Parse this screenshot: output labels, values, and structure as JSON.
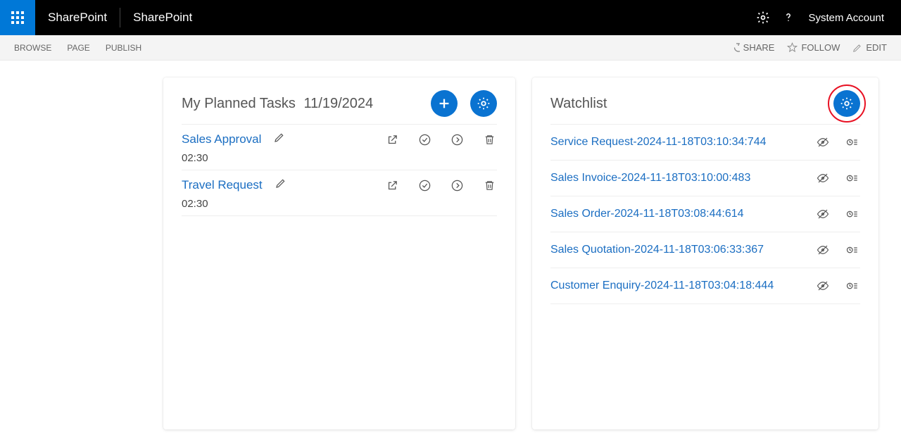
{
  "suiteBar": {
    "brand1": "SharePoint",
    "brand2": "SharePoint",
    "account": "System Account"
  },
  "ribbon": {
    "tabs": [
      "BROWSE",
      "PAGE",
      "PUBLISH"
    ],
    "actions": {
      "share": "SHARE",
      "follow": "FOLLOW",
      "edit": "EDIT"
    }
  },
  "tasksCard": {
    "title": "My Planned Tasks",
    "date": "11/19/2024",
    "rows": [
      {
        "name": "Sales Approval",
        "time": "02:30"
      },
      {
        "name": "Travel Request",
        "time": "02:30"
      }
    ]
  },
  "watchCard": {
    "title": "Watchlist",
    "rows": [
      {
        "name": "Service Request-2024-11-18T03:10:34:744"
      },
      {
        "name": "Sales Invoice-2024-11-18T03:10:00:483"
      },
      {
        "name": "Sales Order-2024-11-18T03:08:44:614"
      },
      {
        "name": "Sales Quotation-2024-11-18T03:06:33:367"
      },
      {
        "name": "Customer Enquiry-2024-11-18T03:04:18:444"
      }
    ]
  }
}
